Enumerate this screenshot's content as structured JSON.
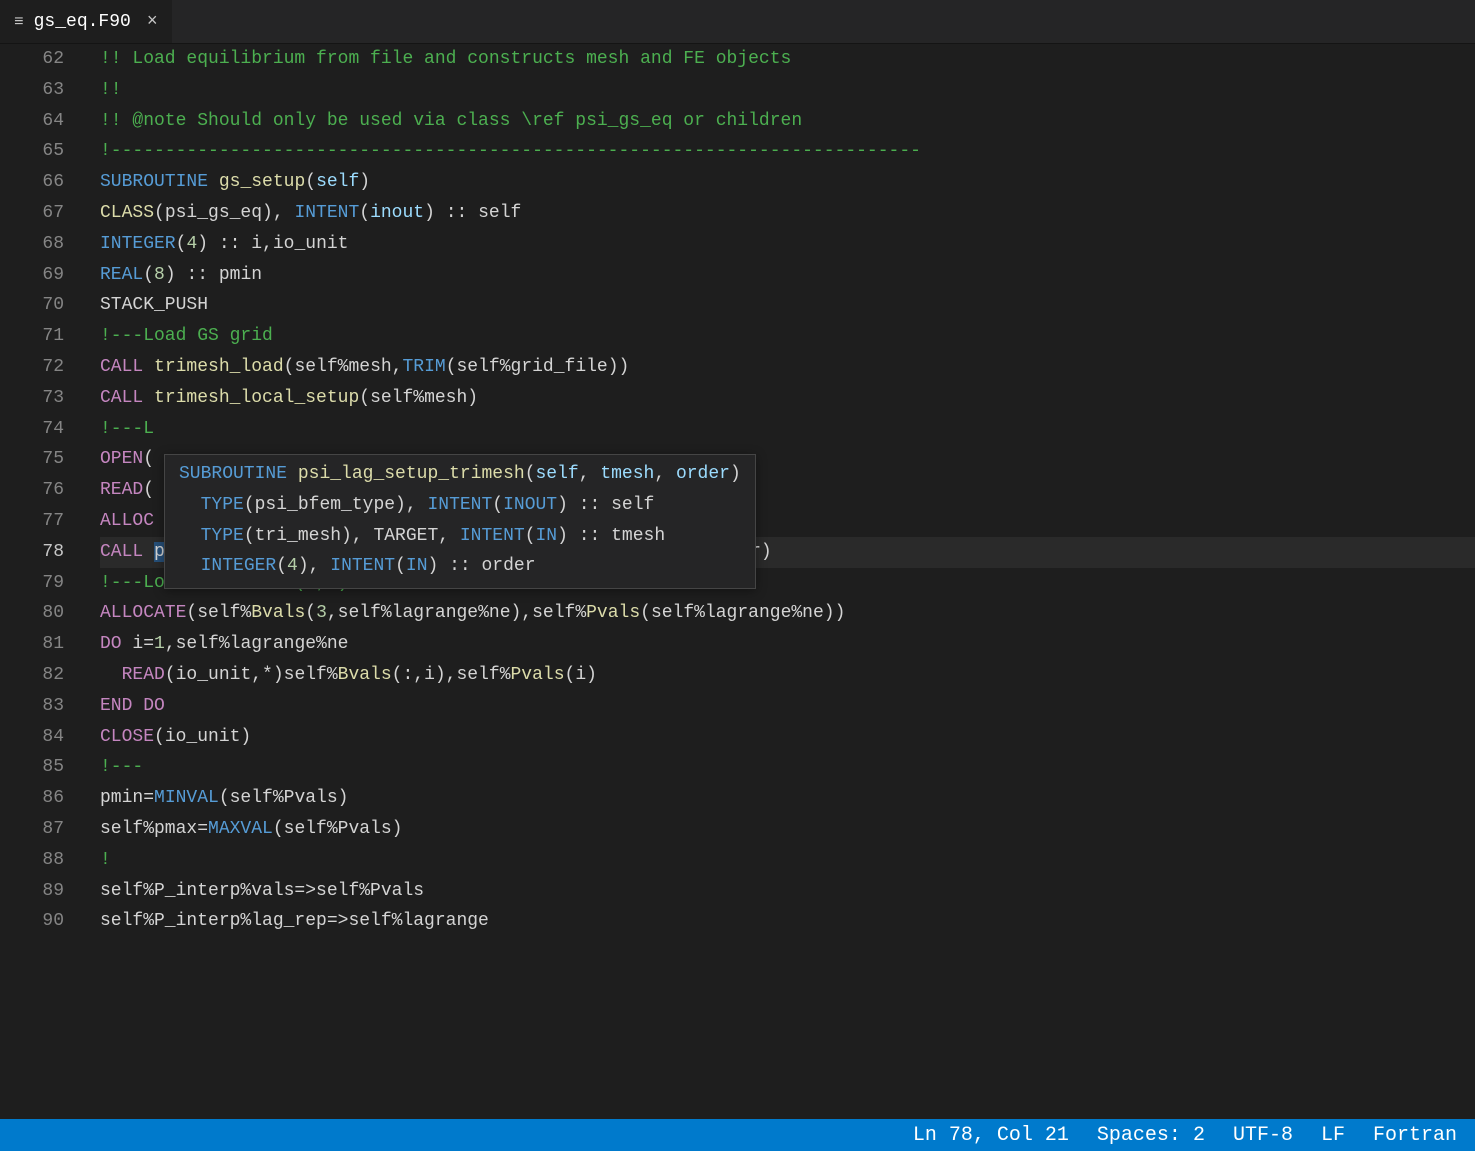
{
  "tab": {
    "file_name": "gs_eq.F90",
    "file_icon_glyph": "≡",
    "close_glyph": "×"
  },
  "gutter": {
    "start": 62,
    "end": 90,
    "active": 78
  },
  "code_lines": {
    "62": [
      [
        "tok-com",
        "!! Load equilibrium from file and constructs mesh and FE objects"
      ]
    ],
    "63": [
      [
        "tok-com",
        "!!"
      ]
    ],
    "64": [
      [
        "tok-com",
        "!! @note Should only be used via class \\ref psi_gs_eq or children"
      ]
    ],
    "65": [
      [
        "tok-com",
        "!---------------------------------------------------------------------------"
      ]
    ],
    "66": [
      [
        "tok-kw",
        "SUBROUTINE"
      ],
      [
        "tok-txt",
        " "
      ],
      [
        "tok-fn",
        "gs_setup"
      ],
      [
        "tok-txt",
        "("
      ],
      [
        "tok-var",
        "self"
      ],
      [
        "tok-txt",
        ")"
      ]
    ],
    "67": [
      [
        "tok-fn",
        "CLASS"
      ],
      [
        "tok-txt",
        "(psi_gs_eq), "
      ],
      [
        "tok-kw",
        "INTENT"
      ],
      [
        "tok-txt",
        "("
      ],
      [
        "tok-var",
        "inout"
      ],
      [
        "tok-txt",
        ") :: self"
      ]
    ],
    "68": [
      [
        "tok-kw",
        "INTEGER"
      ],
      [
        "tok-txt",
        "("
      ],
      [
        "tok-num",
        "4"
      ],
      [
        "tok-txt",
        ") :: i,io_unit"
      ]
    ],
    "69": [
      [
        "tok-kw",
        "REAL"
      ],
      [
        "tok-txt",
        "("
      ],
      [
        "tok-num",
        "8"
      ],
      [
        "tok-txt",
        ") :: pmin"
      ]
    ],
    "70": [
      [
        "tok-txt",
        "STACK_PUSH"
      ]
    ],
    "71": [
      [
        "tok-com",
        "!---Load GS grid"
      ]
    ],
    "72": [
      [
        "tok-call",
        "CALL"
      ],
      [
        "tok-txt",
        " "
      ],
      [
        "tok-fn",
        "trimesh_load"
      ],
      [
        "tok-txt",
        "(self%mesh,"
      ],
      [
        "tok-kw",
        "TRIM"
      ],
      [
        "tok-txt",
        "(self%grid_file))"
      ]
    ],
    "73": [
      [
        "tok-call",
        "CALL"
      ],
      [
        "tok-txt",
        " "
      ],
      [
        "tok-fn",
        "trimesh_local_setup"
      ],
      [
        "tok-txt",
        "(self%mesh)"
      ]
    ],
    "74": [
      [
        "tok-com",
        "!---L"
      ]
    ],
    "75": [
      [
        "tok-call",
        "OPEN"
      ],
      [
        "tok-txt",
        "("
      ]
    ],
    "76": [
      [
        "tok-call",
        "READ"
      ],
      [
        "tok-txt",
        "("
      ]
    ],
    "77": [
      [
        "tok-call",
        "ALLOC"
      ]
    ],
    "78": [
      [
        "tok-call",
        "CALL"
      ],
      [
        "tok-txt",
        " "
      ],
      [
        "sel",
        "psi_lag_setup_t"
      ],
      [
        "tok-fn",
        "rimesh"
      ],
      [
        "tok-txt",
        "(self%lagrange,self%mesh,self%order)"
      ]
    ],
    "79": [
      [
        "tok-com",
        "!---Load GS field (B,P)"
      ]
    ],
    "80": [
      [
        "tok-call",
        "ALLOCATE"
      ],
      [
        "tok-txt",
        "(self%"
      ],
      [
        "tok-fn",
        "Bvals"
      ],
      [
        "tok-txt",
        "("
      ],
      [
        "tok-num",
        "3"
      ],
      [
        "tok-txt",
        ",self%lagrange%ne),self%"
      ],
      [
        "tok-fn",
        "Pvals"
      ],
      [
        "tok-txt",
        "(self%lagrange%ne))"
      ]
    ],
    "81": [
      [
        "tok-call",
        "DO"
      ],
      [
        "tok-txt",
        " i="
      ],
      [
        "tok-num",
        "1"
      ],
      [
        "tok-txt",
        ",self%lagrange%ne"
      ]
    ],
    "82": [
      [
        "tok-txt",
        "  "
      ],
      [
        "tok-call",
        "READ"
      ],
      [
        "tok-txt",
        "(io_unit,*)self%"
      ],
      [
        "tok-fn",
        "Bvals"
      ],
      [
        "tok-txt",
        "(:,i),self%"
      ],
      [
        "tok-fn",
        "Pvals"
      ],
      [
        "tok-txt",
        "(i)"
      ]
    ],
    "83": [
      [
        "tok-call",
        "END DO"
      ]
    ],
    "84": [
      [
        "tok-call",
        "CLOSE"
      ],
      [
        "tok-txt",
        "(io_unit)"
      ]
    ],
    "85": [
      [
        "tok-com",
        "!---"
      ]
    ],
    "86": [
      [
        "tok-txt",
        "pmin="
      ],
      [
        "tok-kw",
        "MINVAL"
      ],
      [
        "tok-txt",
        "(self%Pvals)"
      ]
    ],
    "87": [
      [
        "tok-txt",
        "self%pmax="
      ],
      [
        "tok-kw",
        "MAXVAL"
      ],
      [
        "tok-txt",
        "(self%Pvals)"
      ]
    ],
    "88": [
      [
        "tok-com",
        "!"
      ]
    ],
    "89": [
      [
        "tok-txt",
        "self%P_interp%vals=>self%Pvals"
      ]
    ],
    "90": [
      [
        "tok-txt",
        "self%P_interp%lag_rep=>self%lagrange"
      ]
    ]
  },
  "hover": {
    "lines": [
      [
        [
          "tok-kw",
          "SUBROUTINE"
        ],
        [
          "tok-txt",
          " "
        ],
        [
          "tok-fn",
          "psi_lag_setup_trimesh"
        ],
        [
          "tok-txt",
          "("
        ],
        [
          "tok-var",
          "self"
        ],
        [
          "tok-txt",
          ", "
        ],
        [
          "tok-var",
          "tmesh"
        ],
        [
          "tok-txt",
          ", "
        ],
        [
          "tok-var",
          "order"
        ],
        [
          "tok-txt",
          ")"
        ]
      ],
      [
        [
          "tok-txt",
          "  "
        ],
        [
          "tok-kw",
          "TYPE"
        ],
        [
          "tok-txt",
          "(psi_bfem_type), "
        ],
        [
          "tok-kw",
          "INTENT"
        ],
        [
          "tok-txt",
          "("
        ],
        [
          "tok-kw",
          "INOUT"
        ],
        [
          "tok-txt",
          ") :: self"
        ]
      ],
      [
        [
          "tok-txt",
          "  "
        ],
        [
          "tok-kw",
          "TYPE"
        ],
        [
          "tok-txt",
          "(tri_mesh), TARGET, "
        ],
        [
          "tok-kw",
          "INTENT"
        ],
        [
          "tok-txt",
          "("
        ],
        [
          "tok-kw",
          "IN"
        ],
        [
          "tok-txt",
          ") :: tmesh"
        ]
      ],
      [
        [
          "tok-txt",
          "  "
        ],
        [
          "tok-kw",
          "INTEGER"
        ],
        [
          "tok-txt",
          "("
        ],
        [
          "tok-num",
          "4"
        ],
        [
          "tok-txt",
          "), "
        ],
        [
          "tok-kw",
          "INTENT"
        ],
        [
          "tok-txt",
          "("
        ],
        [
          "tok-kw",
          "IN"
        ],
        [
          "tok-txt",
          ") :: order"
        ]
      ]
    ]
  },
  "status": {
    "lncol": "Ln 78, Col 21",
    "spaces": "Spaces: 2",
    "encoding": "UTF-8",
    "eol": "LF",
    "language": "Fortran"
  }
}
